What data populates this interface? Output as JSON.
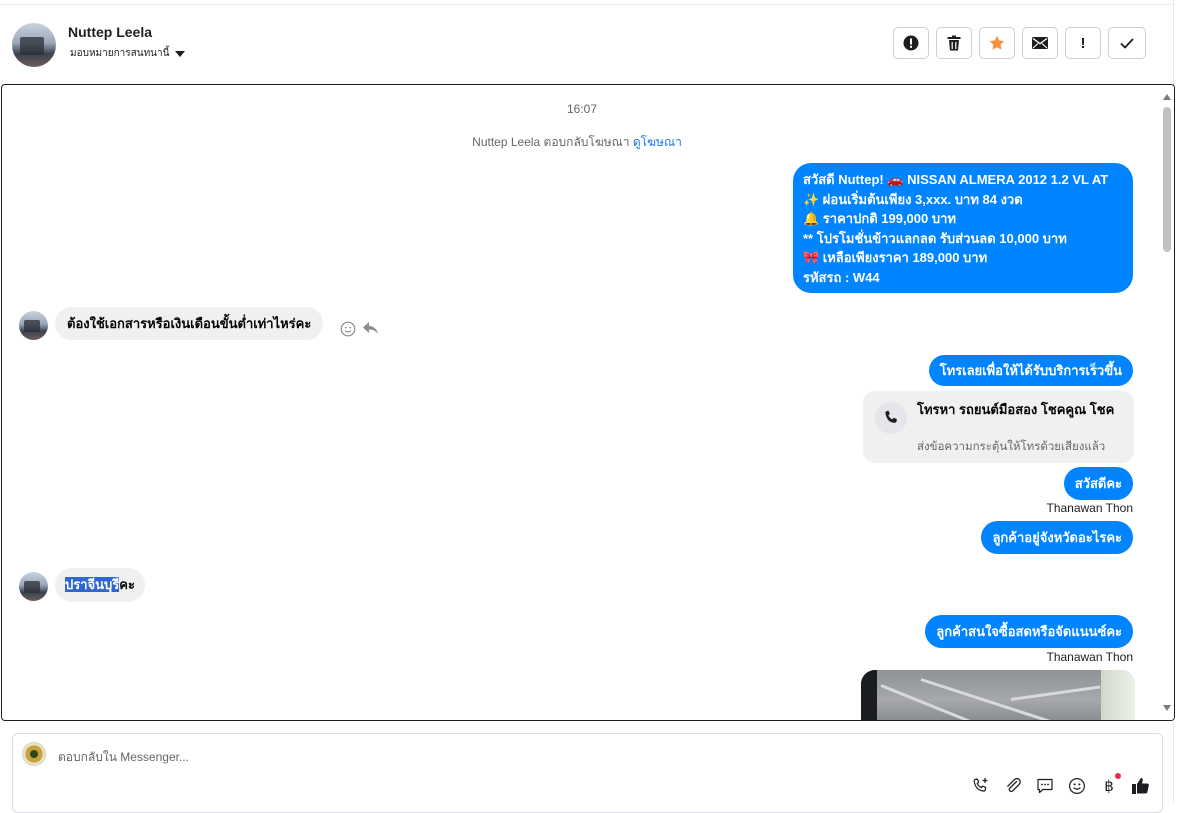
{
  "header": {
    "name": "Nuttep Leela",
    "assign_label": "มอบหมายการสนทนานี้",
    "actions": [
      {
        "icon": "exclamation-circle-icon"
      },
      {
        "icon": "trash-icon"
      },
      {
        "icon": "star-icon",
        "color": "#f7923b"
      },
      {
        "icon": "envelope-icon"
      },
      {
        "icon": "exclamation-mark-icon",
        "label": "!"
      },
      {
        "icon": "checkmark-icon"
      }
    ]
  },
  "chat": {
    "timestamp": "16:07",
    "ad_reply": {
      "text": "Nuttep Leela ตอบกลับโฆษณา",
      "link": "ดูโฆษณา"
    },
    "outgoing_1": {
      "lines": [
        "สวัสดี Nuttep! 🚗  NISSAN ALMERA 2012 1.2 VL AT",
        "✨ ผ่อนเริ่มต้นเพียง 3,xxx. บาท 84 งวด",
        "🔔 ราคาปกติ 199,000 บาท",
        "** โปรโมชั่นข้าวแลกลด รับส่วนลด 10,000 บาท",
        "🎀 เหลือเพียงราคา 189,000 บาท",
        " รหัสรถ : W44"
      ]
    },
    "incoming_1": "ต้องใช้เอกสารหรือเงินเดือนขั้นต่ำเท่าไหร่คะ",
    "outgoing_2": "โทรเลยเพื่อให้ได้รับบริการเร็วขึ้น",
    "call_card": {
      "title": "โทรหา รถยนต์มือสอง โชคคูณ โชค",
      "subtitle": "ส่งข้อความกระตุ้นให้โทรด้วยเสียงแล้ว"
    },
    "outgoing_3": "สวัสดีคะ",
    "sender_1": "Thanawan Thon",
    "outgoing_4": "ลูกค้าอยู่จังหวัดอะไรคะ",
    "incoming_2": {
      "highlighted": "ปราจีนบุรี",
      "rest": "คะ"
    },
    "outgoing_5": "ลูกค้าสนใจซื้อสดหรือจัดแนนซ์คะ",
    "sender_2": "Thanawan Thon"
  },
  "composer": {
    "placeholder": "ตอบกลับใน Messenger...",
    "tools": [
      "phone-plus-icon",
      "paperclip-icon",
      "saved-reply-icon",
      "emoji-icon",
      "baht-icon",
      "thumbs-up-icon"
    ],
    "baht_symbol": "฿"
  },
  "colors": {
    "accent": "#0084ff",
    "bubble_in": "#f0f0f0",
    "link": "#1877f2",
    "star": "#f7923b"
  }
}
